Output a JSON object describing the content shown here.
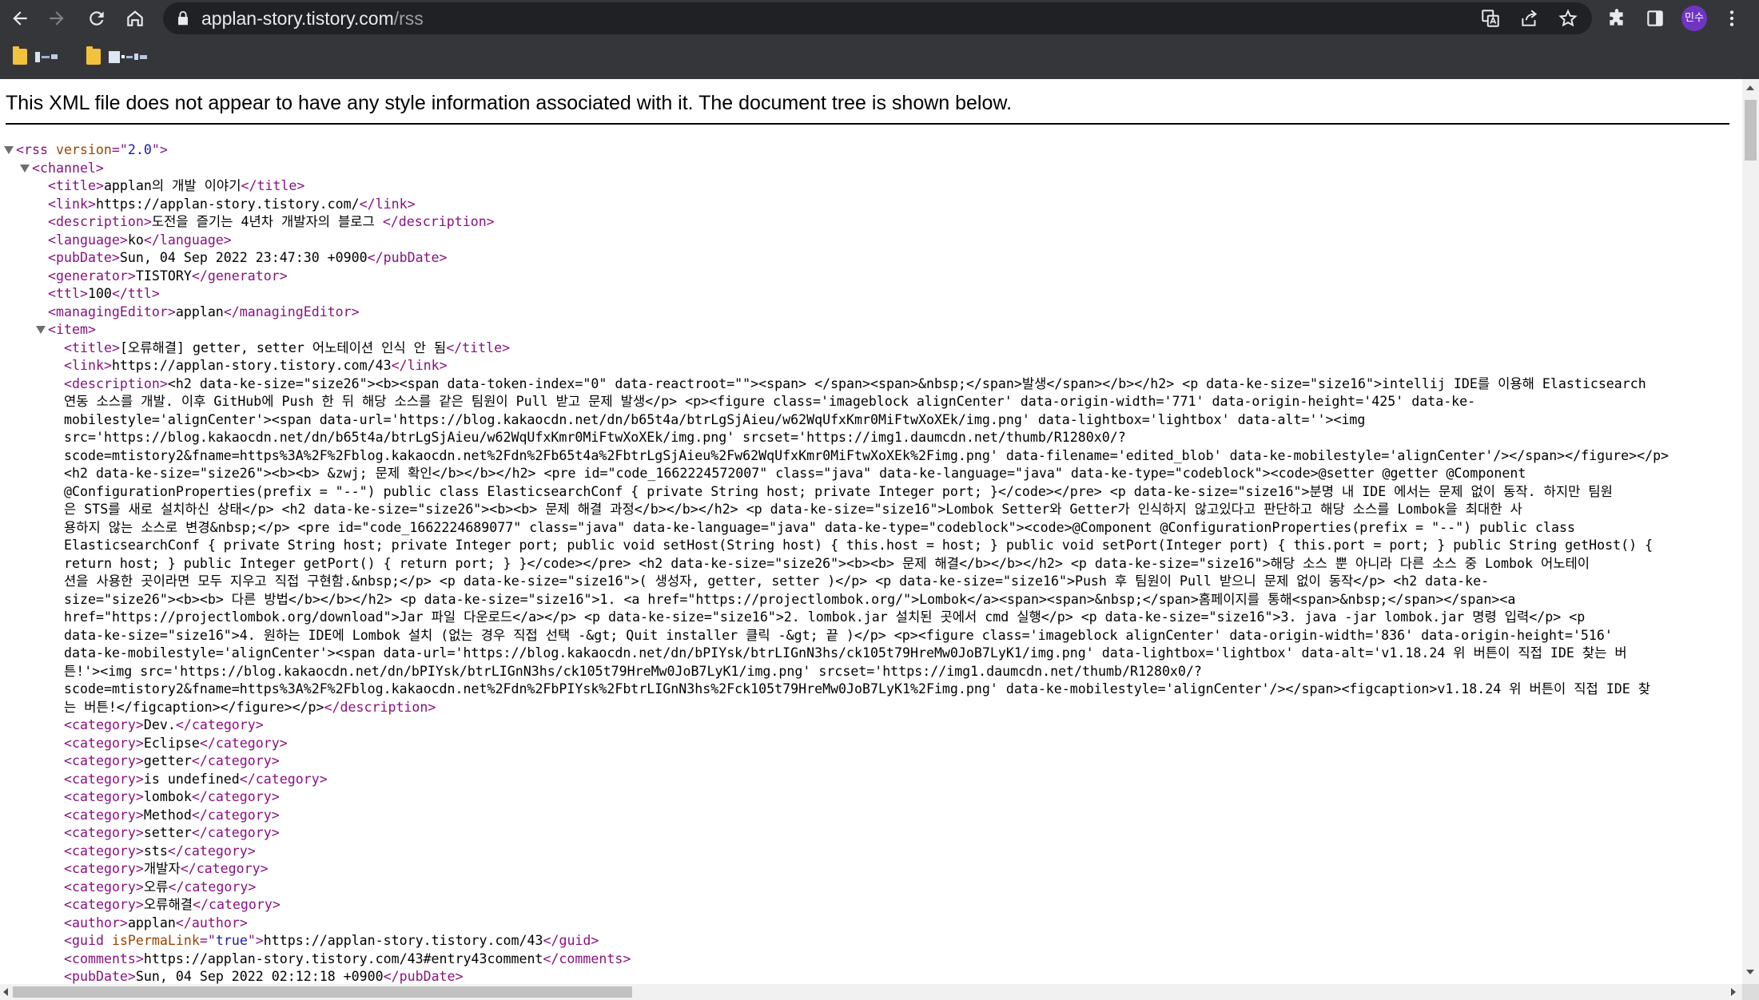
{
  "browser": {
    "url_host": "applan-story.tistory.com",
    "url_path": "/rss",
    "profile_label": "민수",
    "icons": {
      "back": "back-arrow-icon",
      "forward": "forward-arrow-icon",
      "reload": "reload-icon",
      "home": "home-icon",
      "lock": "lock-icon",
      "translate": "translate-icon",
      "share": "share-icon",
      "bookmark": "star-icon",
      "extensions": "puzzle-icon",
      "side_panel": "side-panel-icon",
      "menu": "kebab-menu-icon"
    },
    "colors": {
      "chrome": "#35363a",
      "omnibox": "#202124",
      "avatar": "#6f35c2"
    }
  },
  "bookmarks_bar": {
    "items": [
      {
        "icon": "folder-icon"
      },
      {
        "icon": "folder-icon"
      }
    ]
  },
  "page": {
    "banner": "This XML file does not appear to have any style information associated with it. The document tree is shown below.",
    "colors": {
      "tag": "#881280",
      "attr": "#994500",
      "value": "#1a1aa6"
    },
    "lines": [
      [
        [
          "t",
          "<rss "
        ],
        [
          "a",
          "version"
        ],
        [
          "t",
          "=\""
        ],
        [
          "v",
          "2.0"
        ],
        [
          "t",
          "\">"
        ]
      ],
      [
        [
          "t",
          "<channel>"
        ]
      ],
      [
        [
          "t",
          "<title>"
        ],
        [
          "x",
          "applan의 개발 이야기"
        ],
        [
          "t",
          "</title>"
        ]
      ],
      [
        [
          "t",
          "<link>"
        ],
        [
          "x",
          "https://applan-story.tistory.com/"
        ],
        [
          "t",
          "</link>"
        ]
      ],
      [
        [
          "t",
          "<description>"
        ],
        [
          "x",
          "도전을 즐기는 4년차 개발자의 블로그 "
        ],
        [
          "t",
          "</description>"
        ]
      ],
      [
        [
          "t",
          "<language>"
        ],
        [
          "x",
          "ko"
        ],
        [
          "t",
          "</language>"
        ]
      ],
      [
        [
          "t",
          "<pubDate>"
        ],
        [
          "x",
          "Sun, 04 Sep 2022 23:47:30 +0900"
        ],
        [
          "t",
          "</pubDate>"
        ]
      ],
      [
        [
          "t",
          "<generator>"
        ],
        [
          "x",
          "TISTORY"
        ],
        [
          "t",
          "</generator>"
        ]
      ],
      [
        [
          "t",
          "<ttl>"
        ],
        [
          "x",
          "100"
        ],
        [
          "t",
          "</ttl>"
        ]
      ],
      [
        [
          "t",
          "<managingEditor>"
        ],
        [
          "x",
          "applan"
        ],
        [
          "t",
          "</managingEditor>"
        ]
      ],
      [
        [
          "t",
          "<item>"
        ]
      ],
      [
        [
          "t",
          "<title>"
        ],
        [
          "x",
          "[오류해결] getter, setter 어노테이션 인식 안 됨"
        ],
        [
          "t",
          "</title>"
        ]
      ],
      [
        [
          "t",
          "<link>"
        ],
        [
          "x",
          "https://applan-story.tistory.com/43"
        ],
        [
          "t",
          "</link>"
        ]
      ],
      [
        [
          "t",
          "<description>"
        ],
        [
          "x",
          "<h2 data-ke-size=\"size26\"><b><span data-token-index=\"0\" data-reactroot=\"\"><span> </span><span>&nbsp;</span>발생</span></b></h2> <p data-ke-size=\"size16\">intellij IDE를 이용해 Elasticsearch"
        ]
      ],
      [
        [
          "x",
          "연동 소스를 개발. 이후 GitHub에 Push 한 뒤 해당 소스를 같은 팀원이 Pull 받고 문제 발생</p> <p><figure class='imageblock alignCenter' data-origin-width='771' data-origin-height='425' data-ke-"
        ]
      ],
      [
        [
          "x",
          "mobilestyle='alignCenter'><span data-url='https://blog.kakaocdn.net/dn/b65t4a/btrLgSjAieu/w62WqUfxKmr0MiFtwXoXEk/img.png' data-lightbox='lightbox' data-alt=''><img"
        ]
      ],
      [
        [
          "x",
          "src='https://blog.kakaocdn.net/dn/b65t4a/btrLgSjAieu/w62WqUfxKmr0MiFtwXoXEk/img.png' srcset='https://img1.daumcdn.net/thumb/R1280x0/?"
        ]
      ],
      [
        [
          "x",
          "scode=mtistory2&fname=https%3A%2F%2Fblog.kakaocdn.net%2Fdn%2Fb65t4a%2FbtrLgSjAieu%2Fw62WqUfxKmr0MiFtwXoXEk%2Fimg.png' data-filename='edited_blob' data-ke-mobilestyle='alignCenter'/></span></figure></p>"
        ]
      ],
      [
        [
          "x",
          "<h2 data-ke-size=\"size26\"><b><b> &zwj; 문제 확인</b></b></h2> <pre id=\"code_1662224572007\" class=\"java\" data-ke-language=\"java\" data-ke-type=\"codeblock\"><code>@setter @getter @Component"
        ]
      ],
      [
        [
          "x",
          "@ConfigurationProperties(prefix = \"--\") public class ElasticsearchConf { private String host; private Integer port; }</code></pre> <p data-ke-size=\"size16\">분명 내 IDE 에서는 문제 없이 동작. 하지만 팀원"
        ]
      ],
      [
        [
          "x",
          "은 STS를 새로 설치하신 상태</p> <h2 data-ke-size=\"size26\"><b><b> 문제 해결 과정</b></b></h2> <p data-ke-size=\"size16\">Lombok Setter와 Getter가 인식하지 않고있다고 판단하고 해당 소스를 Lombok을 최대한 사"
        ]
      ],
      [
        [
          "x",
          "용하지 않는 소스로 변경&nbsp;</p> <pre id=\"code_1662224689077\" class=\"java\" data-ke-language=\"java\" data-ke-type=\"codeblock\"><code>@Component @ConfigurationProperties(prefix = \"--\") public class"
        ]
      ],
      [
        [
          "x",
          "ElasticsearchConf { private String host; private Integer port; public void setHost(String host) { this.host = host; } public void setPort(Integer port) { this.port = port; } public String getHost() {"
        ]
      ],
      [
        [
          "x",
          "return host; } public Integer getPort() { return port; } }</code></pre> <h2 data-ke-size=\"size26\"><b><b> 문제 해결</b></b></h2> <p data-ke-size=\"size16\">해당 소스 뿐 아니라 다른 소스 중 Lombok 어노테이"
        ]
      ],
      [
        [
          "x",
          "션을 사용한 곳이라면 모두 지우고 직접 구현함.&nbsp;</p> <p data-ke-size=\"size16\">( 생성자, getter, setter )</p> <p data-ke-size=\"size16\">Push 후 팀원이 Pull 받으니 문제 없이 동작</p> <h2 data-ke-"
        ]
      ],
      [
        [
          "x",
          "size=\"size26\"><b><b> 다른 방법</b></b></h2> <p data-ke-size=\"size16\">1. <a href=\"https://projectlombok.org/\">Lombok</a><span><span>&nbsp;</span>홈페이지를 통해<span>&nbsp;</span></span><a"
        ]
      ],
      [
        [
          "x",
          "href=\"https://projectlombok.org/download\">Jar 파일 다운로드</a></p> <p data-ke-size=\"size16\">2. lombok.jar 설치된 곳에서 cmd 실행</p> <p data-ke-size=\"size16\">3. java -jar lombok.jar 명령 입력</p> <p"
        ]
      ],
      [
        [
          "x",
          "data-ke-size=\"size16\">4. 원하는 IDE에 Lombok 설치 (없는 경우 직접 선택 -&gt; Quit installer 클릭 -&gt; 끝 )</p> <p><figure class='imageblock alignCenter' data-origin-width='836' data-origin-height='516'"
        ]
      ],
      [
        [
          "x",
          "data-ke-mobilestyle='alignCenter'><span data-url='https://blog.kakaocdn.net/dn/bPIYsk/btrLIGnN3hs/ck105t79HreMw0JoB7LyK1/img.png' data-lightbox='lightbox' data-alt='v1.18.24 위 버튼이 직접 IDE 찾는 버"
        ]
      ],
      [
        [
          "x",
          "튼!'><img src='https://blog.kakaocdn.net/dn/bPIYsk/btrLIGnN3hs/ck105t79HreMw0JoB7LyK1/img.png' srcset='https://img1.daumcdn.net/thumb/R1280x0/?"
        ]
      ],
      [
        [
          "x",
          "scode=mtistory2&fname=https%3A%2F%2Fblog.kakaocdn.net%2Fdn%2FbPIYsk%2FbtrLIGnN3hs%2Fck105t79HreMw0JoB7LyK1%2Fimg.png' data-ke-mobilestyle='alignCenter'/></span><figcaption>v1.18.24 위 버튼이 직접 IDE 찾"
        ]
      ],
      [
        [
          "x",
          "는 버튼!</figcaption></figure></p>"
        ],
        [
          "t",
          "</description>"
        ]
      ],
      [
        [
          "t",
          "<category>"
        ],
        [
          "x",
          "Dev."
        ],
        [
          "t",
          "</category>"
        ]
      ],
      [
        [
          "t",
          "<category>"
        ],
        [
          "x",
          "Eclipse"
        ],
        [
          "t",
          "</category>"
        ]
      ],
      [
        [
          "t",
          "<category>"
        ],
        [
          "x",
          "getter"
        ],
        [
          "t",
          "</category>"
        ]
      ],
      [
        [
          "t",
          "<category>"
        ],
        [
          "x",
          "is undefined"
        ],
        [
          "t",
          "</category>"
        ]
      ],
      [
        [
          "t",
          "<category>"
        ],
        [
          "x",
          "lombok"
        ],
        [
          "t",
          "</category>"
        ]
      ],
      [
        [
          "t",
          "<category>"
        ],
        [
          "x",
          "Method"
        ],
        [
          "t",
          "</category>"
        ]
      ],
      [
        [
          "t",
          "<category>"
        ],
        [
          "x",
          "setter"
        ],
        [
          "t",
          "</category>"
        ]
      ],
      [
        [
          "t",
          "<category>"
        ],
        [
          "x",
          "sts"
        ],
        [
          "t",
          "</category>"
        ]
      ],
      [
        [
          "t",
          "<category>"
        ],
        [
          "x",
          "개발자"
        ],
        [
          "t",
          "</category>"
        ]
      ],
      [
        [
          "t",
          "<category>"
        ],
        [
          "x",
          "오류"
        ],
        [
          "t",
          "</category>"
        ]
      ],
      [
        [
          "t",
          "<category>"
        ],
        [
          "x",
          "오류해결"
        ],
        [
          "t",
          "</category>"
        ]
      ],
      [
        [
          "t",
          "<author>"
        ],
        [
          "x",
          "applan"
        ],
        [
          "t",
          "</author>"
        ]
      ],
      [
        [
          "t",
          "<guid "
        ],
        [
          "a",
          "isPermaLink"
        ],
        [
          "t",
          "=\""
        ],
        [
          "v",
          "true"
        ],
        [
          "t",
          "\">"
        ],
        [
          "x",
          "https://applan-story.tistory.com/43"
        ],
        [
          "t",
          "</guid>"
        ]
      ],
      [
        [
          "t",
          "<comments>"
        ],
        [
          "x",
          "https://applan-story.tistory.com/43#entry43comment"
        ],
        [
          "t",
          "</comments>"
        ]
      ],
      [
        [
          "t",
          "<pubDate>"
        ],
        [
          "x",
          "Sun, 04 Sep 2022 02:12:18 +0900"
        ],
        [
          "t",
          "</pubDate>"
        ]
      ]
    ]
  }
}
